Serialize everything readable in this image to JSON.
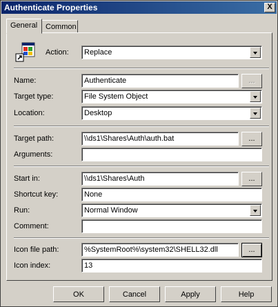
{
  "window": {
    "title": "Authenticate Properties",
    "close_label": "X"
  },
  "tabs": [
    {
      "label": "General",
      "active": true
    },
    {
      "label": "Common",
      "active": false
    }
  ],
  "fields": {
    "action": {
      "label": "Action:",
      "value": "Replace"
    },
    "name": {
      "label": "Name:",
      "value": "Authenticate"
    },
    "target_type": {
      "label": "Target type:",
      "value": "File System Object"
    },
    "location": {
      "label": "Location:",
      "value": "Desktop"
    },
    "target_path": {
      "label": "Target path:",
      "value": "\\\\ds1\\Shares\\Auth\\auth.bat"
    },
    "arguments": {
      "label": "Arguments:",
      "value": ""
    },
    "start_in": {
      "label": "Start in:",
      "value": "\\\\ds1\\Shares\\Auth"
    },
    "shortcut_key": {
      "label": "Shortcut key:",
      "value": "None"
    },
    "run": {
      "label": "Run:",
      "value": "Normal Window"
    },
    "comment": {
      "label": "Comment:",
      "value": ""
    },
    "icon_file_path": {
      "label": "Icon file path:",
      "value": "%SystemRoot%\\system32\\SHELL32.dll"
    },
    "icon_index": {
      "label": "Icon index:",
      "value": "13"
    }
  },
  "browse_label": "...",
  "buttons": {
    "ok": "OK",
    "cancel": "Cancel",
    "apply": "Apply",
    "help": "Help"
  }
}
